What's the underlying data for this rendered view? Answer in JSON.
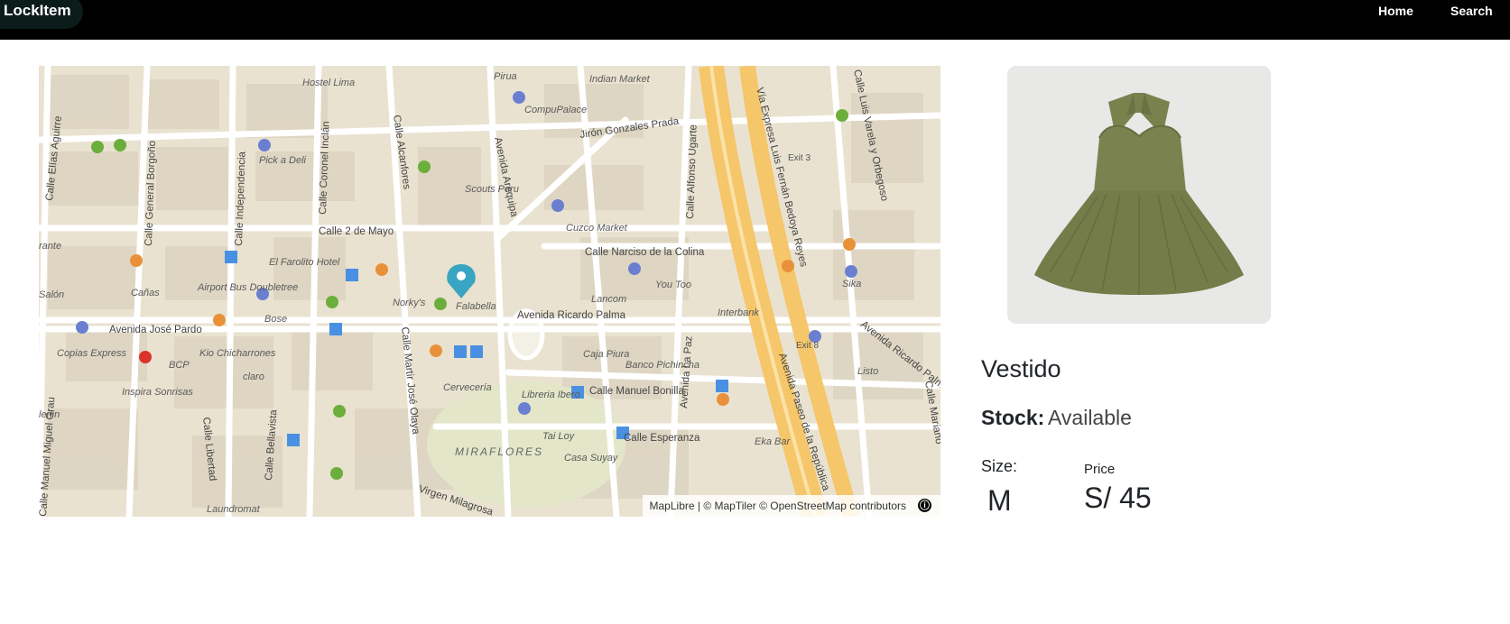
{
  "navbar": {
    "brand": "LockItem",
    "links": [
      "Home",
      "Search"
    ]
  },
  "map": {
    "attribution": "MapLibre | © MapTiler © OpenStreetMap contributors",
    "info_icon": "ⓘ",
    "marker_label": "Falabella",
    "streets": [
      "Avenida Ricardo Palma",
      "Avenida José Pardo",
      "Calle 2 de Mayo",
      "Jirón Gonzales Prada",
      "Calle Narciso de la Colina",
      "Calle Manuel Bonilla",
      "Calle Esperanza",
      "Avenida Arequipa",
      "Vía Expresa Luis Fernán Bedoya Reyes",
      "Calle Alfonso Ugarte",
      "Calle Luis Varela y Orbegoso",
      "Calle Independencia",
      "Calle General Borgoño",
      "Calle Coronel Inclán",
      "Calle Alcanfores",
      "Calle Elías Aguirre",
      "Calle Martir José Olaya",
      "Calle Libertad",
      "Calle Bellavista",
      "Avenida La Paz",
      "Avenida Paseo de la República",
      "Calle Manuel Miguel Grau",
      "Virgen Milagrosa",
      "Calle Mariano",
      "Avenida Ricardo Palma"
    ],
    "pois": [
      "Hostel Lima",
      "Pirua",
      "Indian Market",
      "CompuPalace",
      "Pick a Deli",
      "Scouts Peru",
      "Cuzco Market",
      "El Farolito Hotel",
      "Airport Bus Doubletree",
      "Cañas",
      "Norky's",
      "Bose",
      "You Too",
      "Lancom",
      "Interbank",
      "Sika",
      "Copias Express",
      "Kio Chicharrones",
      "BCP",
      "claro",
      "Inspira Sonrisas",
      "Caja Piura",
      "Banco Pichincha",
      "Cervecería",
      "Libreria Ibero",
      "Listo",
      "Tai Loy",
      "Casa Suyay",
      "Eka Bar",
      "Laundromat",
      "MIRAFLORES",
      "Exit 3",
      "Exit 8",
      "lerlin",
      "rante",
      "Salón"
    ]
  },
  "product": {
    "title": "Vestido",
    "stock_label": "Stock:",
    "stock_value": "Available",
    "size_label": "Size:",
    "size_value": "M",
    "price_label": "Price",
    "price_value": "S/ 45"
  }
}
